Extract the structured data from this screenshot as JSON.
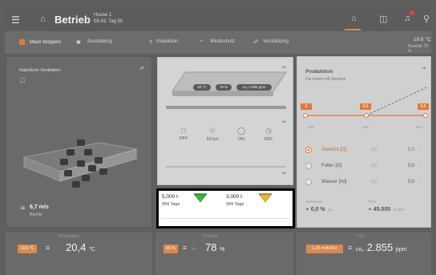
{
  "topbar": {
    "menu_icon": "hamburger-icon",
    "home_icon": "home-icon",
    "title": "Betrieb",
    "house_name": "House 1",
    "house_time": "08:43, Tag 50",
    "right_icons": [
      "home-icon",
      "clipboard-icon",
      "bell-icon",
      "search-icon"
    ]
  },
  "actions": {
    "stop": "Mast stoppen",
    "ausstallung": "Ausstallung",
    "inspektion": "Inspektion",
    "windschutz": "Windschutz",
    "verstaerkung": "Verstärkung",
    "outside_temp": "19,6 °C",
    "outside_hum": "Feuchte 79 %"
  },
  "ventilation": {
    "title": "Natürliche Ventilation",
    "wind_speed": "6,7 m/s",
    "wind_dir": "Rechts"
  },
  "house_view": {
    "temp": "20 °C",
    "hum": "78 %",
    "co2": "co₂ 2.855 ppm",
    "sensors": [
      {
        "icon": "device-icon",
        "value": "OFF"
      },
      {
        "icon": "bulb-icon",
        "value": "50 lux"
      },
      {
        "icon": "water-drop-icon",
        "value": "ON"
      },
      {
        "icon": "clock-icon",
        "value": "OFF"
      }
    ]
  },
  "production": {
    "title": "Produktion",
    "subtitle": "Die letzten 48 Stunden",
    "markers": [
      "0",
      "0,0",
      "0,0"
    ],
    "ticks": [
      "-48h",
      "-24h",
      "jetzt"
    ],
    "rows": [
      {
        "label": "Gewicht [G]",
        "mid": "0,0",
        "value": "0,0",
        "selected": true
      },
      {
        "label": "Futter [G]",
        "mid": "0,0",
        "value": "0,0",
        "selected": false
      },
      {
        "label": "Wasser [ml]",
        "mid": "0,0",
        "value": "0,0",
        "selected": false
      }
    ],
    "footer": {
      "left_label": "Verlustrate",
      "left_value": "0,0 %",
      "left_small": "0,0",
      "right_label": "Tiere",
      "right_value": "45.000",
      "right_small": "45.000"
    }
  },
  "stock": {
    "items": [
      {
        "value": "5,000 t",
        "days": "999 Tage",
        "color": "#3cb43c"
      },
      {
        "value": "3,000 t",
        "days": "999 Tage",
        "color": "#e8b830"
      }
    ]
  },
  "bottom": {
    "temp_badge": "19,6 °C",
    "temp_value": "20,4",
    "temp_unit": "°C",
    "temp_label": "Temperatur",
    "hum_badge": "85 %",
    "hum_value": "78",
    "hum_unit": "%",
    "hum_label": "Feuchte",
    "co2_badge": "1,20 m³/h/Tier",
    "co2_value": "2.855",
    "co2_unit": "ppm",
    "co2_label": "CO₂"
  },
  "colors": {
    "accent": "#e07a3c",
    "stock_green": "#3cb43c",
    "stock_yellow": "#e8b830"
  }
}
